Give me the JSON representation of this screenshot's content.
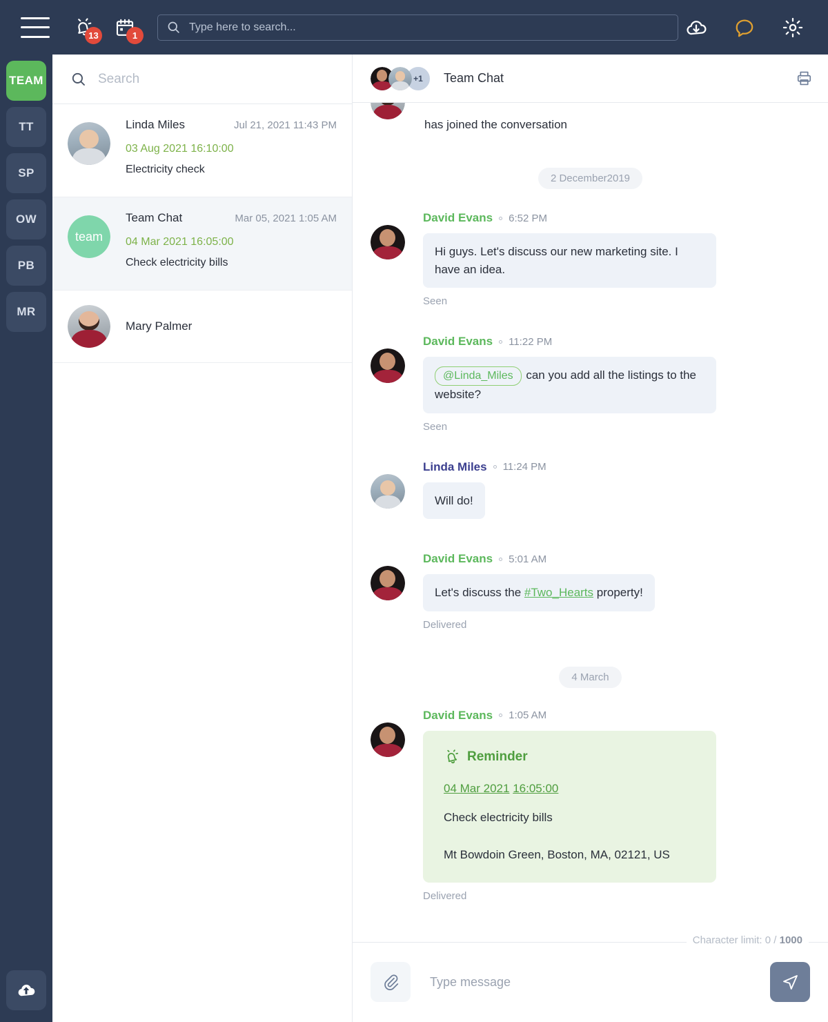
{
  "topbar": {
    "menu_icon": "hamburger-icon",
    "alerts": {
      "icon": "alarm-bell-icon",
      "count": "13"
    },
    "calendar": {
      "icon": "calendar-icon",
      "count": "1"
    },
    "search": {
      "icon": "search-icon",
      "placeholder": "Type here to search...",
      "value": ""
    },
    "actions": [
      {
        "icon": "cloud-download-icon",
        "name": "download-button"
      },
      {
        "icon": "chat-bubble-icon",
        "name": "messages-button",
        "color": "#e0a030"
      },
      {
        "icon": "gear-icon",
        "name": "settings-button"
      }
    ]
  },
  "rail": {
    "items": [
      {
        "label": "TEAM",
        "active": true
      },
      {
        "label": "TT",
        "active": false
      },
      {
        "label": "SP",
        "active": false
      },
      {
        "label": "OW",
        "active": false
      },
      {
        "label": "PB",
        "active": false
      },
      {
        "label": "MR",
        "active": false
      }
    ],
    "upload": {
      "icon": "cloud-upload-icon"
    }
  },
  "conversations": {
    "search": {
      "placeholder": "Search",
      "value": "",
      "icon": "search-icon"
    },
    "items": [
      {
        "name": "Linda Miles",
        "time": "Jul 21, 2021 11:43 PM",
        "reminder_date": "03 Aug 2021 16:10:00",
        "preview": "Electricity check",
        "avatar": "photo-linda",
        "selected": false
      },
      {
        "name": "Team Chat",
        "time": "Mar 05, 2021 1:05 AM",
        "reminder_date": "04 Mar 2021 16:05:00",
        "preview": "Check electricity bills",
        "avatar": "team-initials",
        "avatar_label": "team",
        "selected": true
      },
      {
        "name": "Mary Palmer",
        "time": "",
        "reminder_date": "",
        "preview": "",
        "avatar": "photo-mary",
        "selected": false
      }
    ]
  },
  "chat": {
    "title": "Team Chat",
    "avatar_overflow": "+1",
    "print_icon": "printer-icon",
    "joined_text": "has joined the conversation",
    "separators": {
      "first": "2 December2019",
      "second": "4 March"
    },
    "messages": [
      {
        "author": "David Evans",
        "author_color": "green",
        "time": "6:52 PM",
        "text": "Hi guys. Let's discuss our new marketing site. I have an idea.",
        "status": "Seen",
        "avatar": "photo-david"
      },
      {
        "author": "David Evans",
        "author_color": "green",
        "time": "11:22 PM",
        "mention": "@Linda_Miles",
        "text": " can you add all the listings to the website?",
        "status": "Seen",
        "avatar": "photo-david"
      },
      {
        "author": "Linda Miles",
        "author_color": "blue",
        "time": "11:24 PM",
        "text": "Will do!",
        "status": "",
        "avatar": "photo-linda"
      },
      {
        "author": "David Evans",
        "author_color": "green",
        "time": "5:01 AM",
        "text_before": "Let's discuss the ",
        "hashtag": "#Two_Hearts",
        "text_after": " property!",
        "status": "Delivered",
        "avatar": "photo-david"
      },
      {
        "author": "David Evans",
        "author_color": "green",
        "time": "1:05 AM",
        "status": "Delivered",
        "avatar": "photo-david",
        "reminder": {
          "icon": "alarm-bell-icon",
          "title": "Reminder",
          "date": "04 Mar 2021",
          "clock": "16:05:00",
          "task": "Check electricity bills",
          "address": "Mt Bowdoin Green, Boston, MA, 02121, US"
        }
      }
    ],
    "composer": {
      "char_limit_prefix": "Character limit: 0 / ",
      "char_limit_max": "1000",
      "attach_icon": "paperclip-icon",
      "placeholder": "Type message",
      "value": "",
      "send_icon": "send-icon"
    }
  },
  "colors": {
    "header_bg": "#2d3b54",
    "accent_green": "#5cb85c",
    "badge_red": "#e24a3b",
    "bubble_bg": "#eef2f8",
    "reminder_bg": "#e9f4e2",
    "send_bg": "#6e7e99"
  }
}
